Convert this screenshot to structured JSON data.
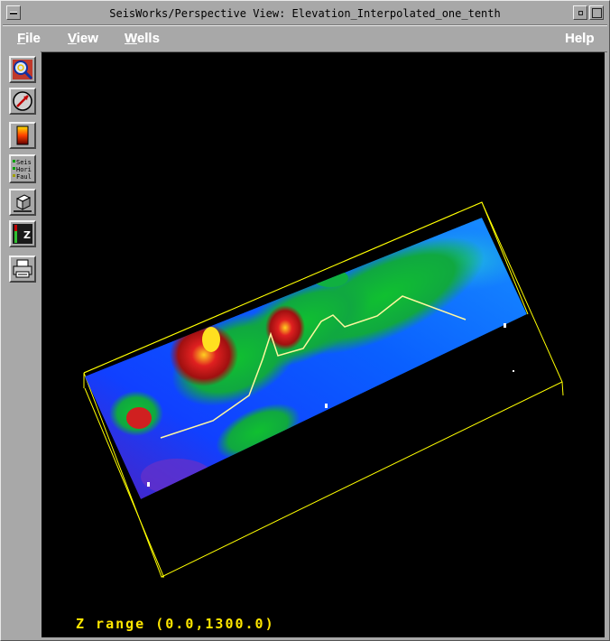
{
  "window": {
    "title": "SeisWorks/Perspective View: Elevation_Interpolated_one_tenth"
  },
  "menubar": {
    "file": {
      "mnemonic": "F",
      "rest": "ile"
    },
    "view": {
      "mnemonic": "V",
      "rest": "iew"
    },
    "wells": {
      "mnemonic": "W",
      "rest": "ells"
    },
    "help": "Help"
  },
  "toolbar": {
    "tools": [
      {
        "icon": "zoom-magnifier-icon"
      },
      {
        "icon": "rotate-compass-icon"
      },
      {
        "icon": "color-bar-icon"
      },
      {
        "icon": "display-layers-icon",
        "lines": [
          "Seis",
          "Hori",
          "Faul"
        ]
      },
      {
        "icon": "perspective-cube-icon"
      },
      {
        "icon": "z-scale-icon",
        "glyph": "Z"
      },
      {
        "icon": "printer-icon"
      }
    ]
  },
  "viewport": {
    "z_range_label": "Z range (0.0,1300.0)"
  },
  "colors": {
    "background": "#000000",
    "frame": "#ffff00",
    "annotation": "#ffe600"
  }
}
